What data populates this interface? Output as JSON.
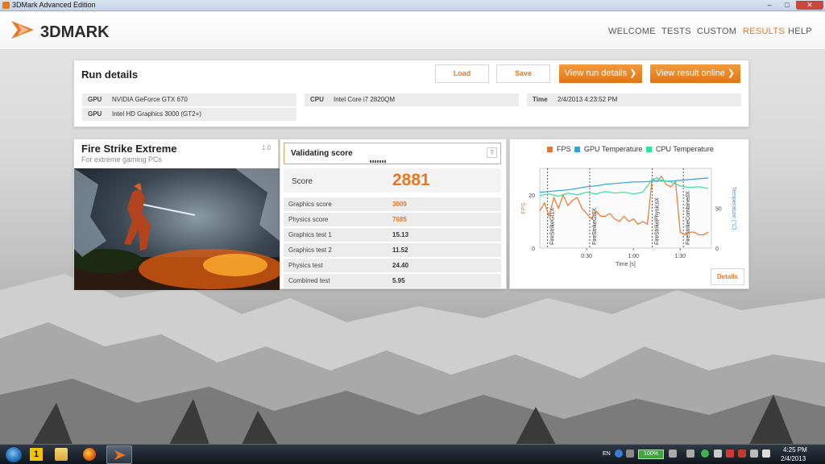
{
  "window": {
    "title": "3DMark Advanced Edition",
    "min": "–",
    "max": "□",
    "close": "✕"
  },
  "app": {
    "logo_text": "3DMARK",
    "nav": [
      {
        "label": "WELCOME",
        "active": false
      },
      {
        "label": "TESTS",
        "active": false
      },
      {
        "label": "CUSTOM",
        "active": false
      },
      {
        "label": "RESULTS",
        "active": true
      },
      {
        "label": "HELP",
        "active": false
      }
    ]
  },
  "run_details": {
    "title": "Run details",
    "load_label": "Load",
    "save_label": "Save",
    "view_run_label": "View run details",
    "view_online_label": "View result online",
    "gpu_key": "GPU",
    "gpu1": "NVIDIA GeForce GTX 670",
    "gpu2": "Intel HD Graphics 3000 (GT2+)",
    "cpu_key": "CPU",
    "cpu": "Intel Core i7 2820QM",
    "time_key": "Time",
    "time": "2/4/2013 4:23:52 PM"
  },
  "test": {
    "name": "Fire Strike Extreme",
    "subtitle": "For extreme gaming PCs",
    "version": "1.0"
  },
  "score": {
    "validating_label": "Validating score",
    "help": "?",
    "score_label": "Score",
    "score_value": "2881",
    "rows": [
      {
        "label": "Graphics score",
        "value": "3009",
        "highlight": true
      },
      {
        "label": "Physics score",
        "value": "7685",
        "highlight": true
      },
      {
        "label": "Graphics test 1",
        "value": "15.13",
        "highlight": false
      },
      {
        "label": "Graphics test 2",
        "value": "11.52",
        "highlight": false
      },
      {
        "label": "Physics test",
        "value": "24.40",
        "highlight": false
      },
      {
        "label": "Combined test",
        "value": "5.95",
        "highlight": false
      }
    ]
  },
  "chart": {
    "legend": [
      {
        "name": "FPS",
        "color": "#e8772e"
      },
      {
        "name": "GPU Temperature",
        "color": "#2ea1e0"
      },
      {
        "name": "CPU Temperature",
        "color": "#2fe39a"
      }
    ],
    "details_label": "Details",
    "y_left_label": "FPS",
    "y_right_label": "Temperature (°C)",
    "x_label": "Time [s]",
    "x_ticks": [
      "0:30",
      "1:00",
      "1:30"
    ],
    "y_left_ticks": [
      "0",
      "20"
    ],
    "y_right_ticks": [
      "0",
      "50"
    ],
    "markers": [
      "FireStrikeGt1X",
      "FireStrikeGt2X",
      "FireStrikePhysicsX",
      "FireStrikeCombinedX"
    ]
  },
  "chart_data": {
    "type": "line",
    "xlabel": "Time [s]",
    "ylabel_left": "FPS",
    "ylabel_right": "Temperature (°C)",
    "x_range": [
      "0:00",
      "1:50"
    ],
    "series": [
      {
        "name": "FPS",
        "axis": "left",
        "x": [
          0,
          3,
          6,
          9,
          12,
          15,
          18,
          21,
          24,
          27,
          30,
          33,
          36,
          39,
          42,
          45,
          48,
          51,
          54,
          57,
          60,
          63,
          66,
          69,
          72,
          75,
          78,
          81,
          84,
          87,
          90,
          93,
          96,
          99,
          102,
          105,
          108
        ],
        "values": [
          14,
          17,
          12,
          19,
          15,
          20,
          16,
          18,
          19,
          15,
          13,
          11,
          14,
          12,
          12,
          13,
          11,
          10,
          12,
          10,
          11,
          9,
          10,
          9,
          26,
          25,
          27,
          24,
          23,
          25,
          6,
          5,
          6,
          6,
          5,
          5,
          6
        ]
      },
      {
        "name": "GPU Temperature",
        "axis": "right",
        "x": [
          0,
          6,
          12,
          18,
          24,
          30,
          36,
          42,
          48,
          54,
          60,
          66,
          72,
          78,
          84,
          90,
          96,
          102,
          108
        ],
        "values": [
          70,
          71,
          72,
          73,
          75,
          77,
          78,
          80,
          81,
          82,
          83,
          83,
          84,
          84,
          84,
          85,
          86,
          87,
          88
        ]
      },
      {
        "name": "CPU Temperature",
        "axis": "right",
        "x": [
          0,
          6,
          12,
          18,
          24,
          30,
          36,
          42,
          48,
          54,
          60,
          66,
          72,
          75,
          78,
          84,
          90,
          96,
          102,
          108
        ],
        "values": [
          66,
          68,
          65,
          69,
          67,
          70,
          68,
          71,
          69,
          70,
          68,
          70,
          86,
          88,
          85,
          83,
          78,
          76,
          77,
          75
        ]
      }
    ],
    "markers_x": [
      5,
      32,
      72,
      92
    ],
    "x_ticks": [
      30,
      60,
      90
    ],
    "ylim_left": [
      0,
      30
    ],
    "ylim_right": [
      0,
      100
    ]
  },
  "taskbar": {
    "lang": "EN",
    "battery": "100%",
    "time": "4:25 PM",
    "date": "2/4/2013"
  }
}
